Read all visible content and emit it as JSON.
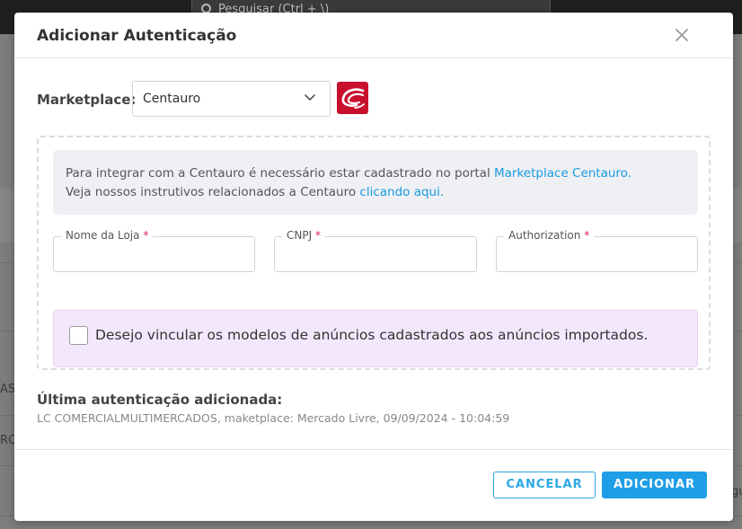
{
  "background": {
    "search_placeholder": "Pesquisar (Ctrl + \\)",
    "left_text_1": "AS",
    "left_text_2": "RO",
    "right_text": "gu"
  },
  "modal": {
    "title": "Adicionar Autenticação",
    "marketplace_label": "Marketplace:",
    "marketplace_selected": "Centauro",
    "marketplace_logo": "centauro-logo",
    "info": {
      "line1_prefix": "Para integrar com a Centauro é necessário estar cadastrado no portal ",
      "line1_link": "Marketplace Centauro",
      "line1_suffix": ".",
      "line2_prefix": "Veja nossos instrutivos relacionados a Centauro ",
      "line2_link": "clicando aqui",
      "line2_suffix": "."
    },
    "fields": [
      {
        "label": "Nome da Loja",
        "required_mark": "*",
        "value": ""
      },
      {
        "label": "CNPJ",
        "required_mark": "*",
        "value": ""
      },
      {
        "label": "Authorization",
        "required_mark": "*",
        "value": ""
      }
    ],
    "checkbox_label": "Desejo vincular os modelos de anúncios cadastrados aos anúncios importados.",
    "checkbox_checked": false,
    "last_auth_title": "Última autenticação adicionada:",
    "last_auth_text": "LC COMERCIALMULTIMERCADOS, maketplace: Mercado Livre, 09/09/2024 - 10:04:59",
    "cancel_label": "CANCELAR",
    "add_label": "ADICIONAR"
  },
  "colors": {
    "accent": "#1e9ee6",
    "required": "#d81b60",
    "logo_red": "#c8102e",
    "checkbar_bg": "#f3e8fb"
  }
}
